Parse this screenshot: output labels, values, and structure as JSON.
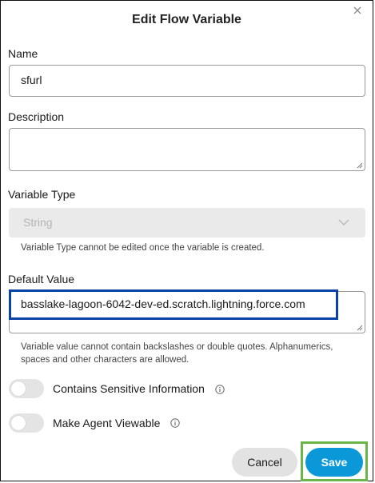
{
  "dialog": {
    "title": "Edit Flow Variable"
  },
  "fields": {
    "name_label": "Name",
    "name_value": "sfurl",
    "description_label": "Description",
    "description_value": "",
    "variable_type_label": "Variable Type",
    "variable_type_value": "String",
    "variable_type_hint": "Variable Type cannot be edited once the variable is created.",
    "default_value_label": "Default Value",
    "default_value_value": "basslake-lagoon-6042-dev-ed.scratch.lightning.force.com",
    "default_value_hint": "Variable value cannot contain backslashes or double quotes. Alphanumerics, spaces and other characters are allowed."
  },
  "toggles": {
    "sensitive_label": "Contains Sensitive Information",
    "sensitive_on": false,
    "agent_viewable_label": "Make Agent Viewable",
    "agent_viewable_on": false
  },
  "footer": {
    "cancel_label": "Cancel",
    "save_label": "Save"
  },
  "colors": {
    "save_button": "#0b98d8",
    "highlight_blue": "#0a43a8",
    "highlight_green": "#6ab547"
  }
}
